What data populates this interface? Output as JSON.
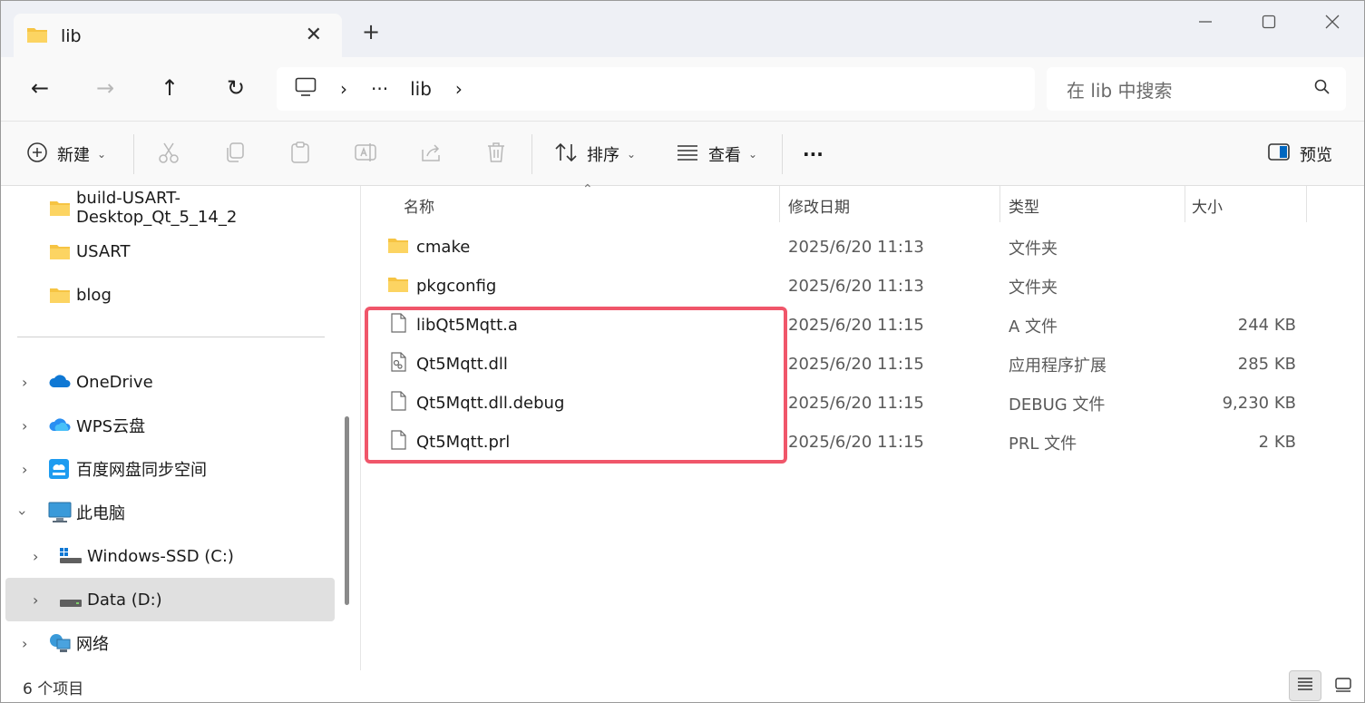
{
  "tab": {
    "title": "lib",
    "close": "✕",
    "new": "+"
  },
  "window_controls": {
    "minimize": "—",
    "maximize": "☐",
    "close": "✕"
  },
  "nav": {
    "back": "←",
    "forward": "→",
    "up": "↑",
    "refresh": "↻"
  },
  "address": {
    "chevron1": "›",
    "ellipsis": "···",
    "folder": "lib",
    "chevron2": "›"
  },
  "search": {
    "placeholder": "在 lib 中搜索"
  },
  "toolbar": {
    "new_label": "新建",
    "sort_label": "排序",
    "view_label": "查看",
    "more_label": "···",
    "preview_label": "预览"
  },
  "sidebar": {
    "quick_items": [
      {
        "label": "build-USART-Desktop_Qt_5_14_2"
      },
      {
        "label": "USART"
      },
      {
        "label": "blog"
      }
    ],
    "tree_items": [
      {
        "label": "OneDrive",
        "icon": "onedrive-icon",
        "expanded": false
      },
      {
        "label": "WPS云盘",
        "icon": "wps-cloud-icon",
        "expanded": false
      },
      {
        "label": "百度网盘同步空间",
        "icon": "baidu-netdisk-icon",
        "expanded": false
      },
      {
        "label": "此电脑",
        "icon": "this-pc-icon",
        "expanded": true
      },
      {
        "label": "Windows-SSD (C:)",
        "icon": "drive-c-icon",
        "expanded": false
      },
      {
        "label": "Data (D:)",
        "icon": "drive-d-icon",
        "expanded": false,
        "selected": true
      },
      {
        "label": "网络",
        "icon": "network-icon",
        "expanded": false
      }
    ]
  },
  "columns": {
    "name": "名称",
    "modified": "修改日期",
    "type": "类型",
    "size": "大小"
  },
  "files": [
    {
      "name": "cmake",
      "modified": "2025/6/20 11:13",
      "type": "文件夹",
      "size": "",
      "icon": "folder-icon"
    },
    {
      "name": "pkgconfig",
      "modified": "2025/6/20 11:13",
      "type": "文件夹",
      "size": "",
      "icon": "folder-icon"
    },
    {
      "name": "libQt5Mqtt.a",
      "modified": "2025/6/20 11:15",
      "type": "A 文件",
      "size": "244 KB",
      "icon": "file-icon"
    },
    {
      "name": "Qt5Mqtt.dll",
      "modified": "2025/6/20 11:15",
      "type": "应用程序扩展",
      "size": "285 KB",
      "icon": "dll-file-icon"
    },
    {
      "name": "Qt5Mqtt.dll.debug",
      "modified": "2025/6/20 11:15",
      "type": "DEBUG 文件",
      "size": "9,230 KB",
      "icon": "file-icon"
    },
    {
      "name": "Qt5Mqtt.prl",
      "modified": "2025/6/20 11:15",
      "type": "PRL 文件",
      "size": "2 KB",
      "icon": "file-icon"
    }
  ],
  "status": {
    "item_count": "6 个项目"
  },
  "colors": {
    "highlight_border": "#f0566a",
    "folder": "#f6c443",
    "selected_bg": "#e0e0e0"
  }
}
